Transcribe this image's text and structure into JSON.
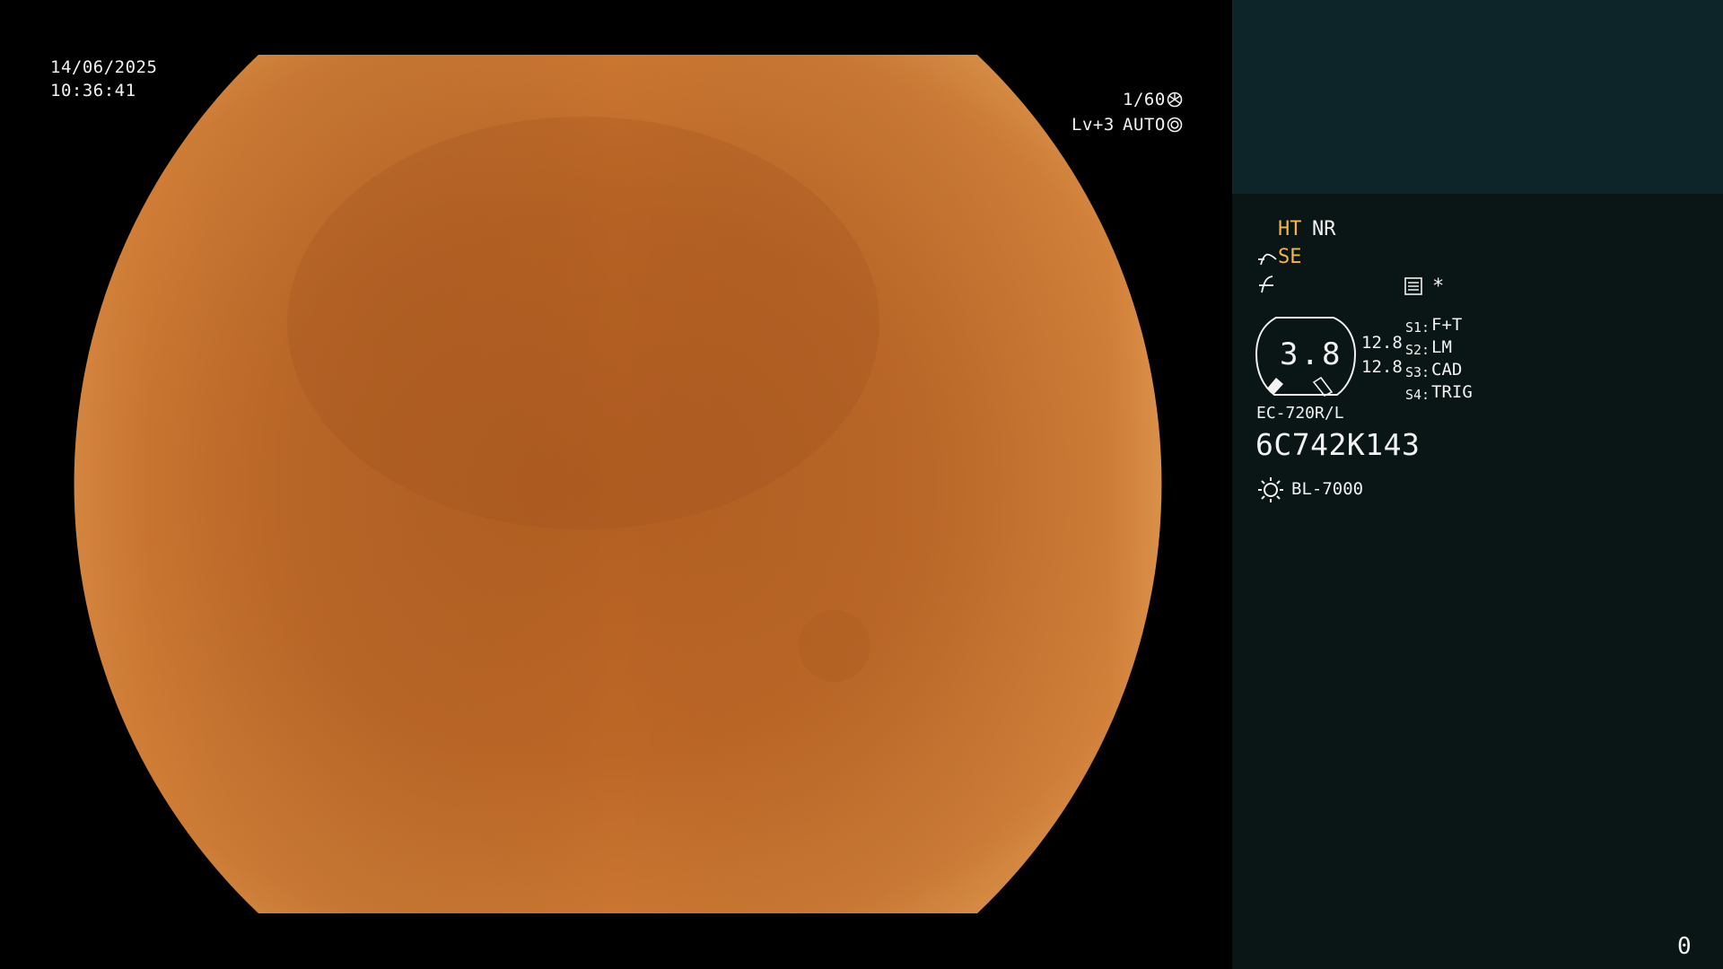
{
  "osd": {
    "date": "14/06/2025",
    "time": "10:36:41",
    "shutter": "1/60",
    "level": "Lv+3",
    "iris_mode": "AUTO"
  },
  "status": {
    "ht": "HT",
    "nr": "NR",
    "se": "SE",
    "asterisk": "*"
  },
  "scope": {
    "diameter": "3.8",
    "channel_top": "12.8",
    "channel_bottom": "12.8",
    "model": "EC-720R/L",
    "serial": "6C742K143"
  },
  "switches": [
    {
      "key": "S1:",
      "value": "F+T"
    },
    {
      "key": "S2:",
      "value": "LM"
    },
    {
      "key": "S3:",
      "value": "CAD"
    },
    {
      "key": "S4:",
      "value": "TRIG"
    }
  ],
  "light_source": "BL-7000",
  "counter": "0",
  "colors": {
    "highlight": "#f6b642",
    "panel_bg": "#0a1515",
    "panel_top_bg": "#0d2528",
    "tissue": "#c5712c"
  }
}
